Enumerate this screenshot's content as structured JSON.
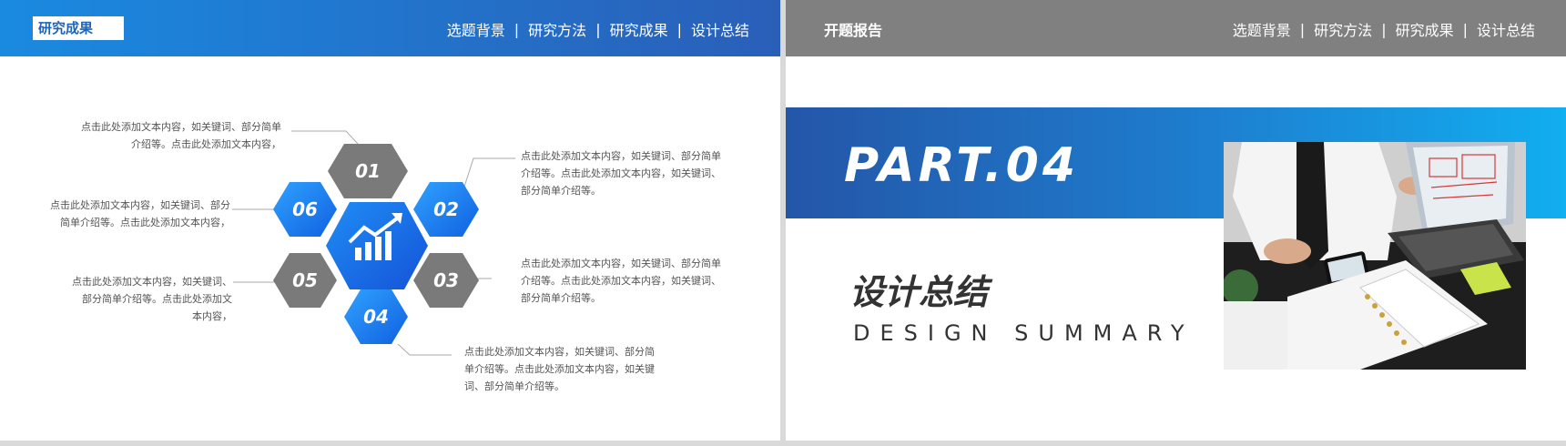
{
  "left_slide": {
    "badge": "研究成果",
    "nav": [
      "选题背景",
      "研究方法",
      "研究成果",
      "设计总结"
    ],
    "hexagons": [
      "01",
      "02",
      "03",
      "04",
      "05",
      "06"
    ],
    "center_icon": "growth-chart-icon",
    "callouts": {
      "c01": [
        "点击此处添加文本内容，如关键词、部分简单",
        "介绍等。点击此处添加文本内容，"
      ],
      "c02": [
        "点击此处添加文本内容，如关键词、部分简单",
        "介绍等。点击此处添加文本内容，如关键词、",
        "部分简单介绍等。"
      ],
      "c03": [
        "点击此处添加文本内容，如关键词、部分简单",
        "介绍等。点击此处添加文本内容，如关键词、",
        "部分简单介绍等。"
      ],
      "c04": [
        "点击此处添加文本内容，如关键词、部分简",
        "单介绍等。点击此处添加文本内容，如关键",
        "词、部分简单介绍等。"
      ],
      "c05": [
        "点击此处添加文本内容，如关键词、",
        "部分简单介绍等。点击此处添加文",
        "本内容，"
      ],
      "c06": [
        "点击此处添加文本内容，如关键词、部分",
        "简单介绍等。点击此处添加文本内容，"
      ]
    },
    "colors": {
      "blue": "#1a6fe8",
      "gray": "#7a7a7a",
      "accent": "#2a5fb8"
    }
  },
  "right_slide": {
    "title": "开题报告",
    "nav": [
      "选题背景",
      "研究方法",
      "研究成果",
      "设计总结"
    ],
    "part": "PART.04",
    "section_cn": "设计总结",
    "section_en": "DESIGN SUMMARY",
    "photo": "office-desk-laptop-photo"
  }
}
